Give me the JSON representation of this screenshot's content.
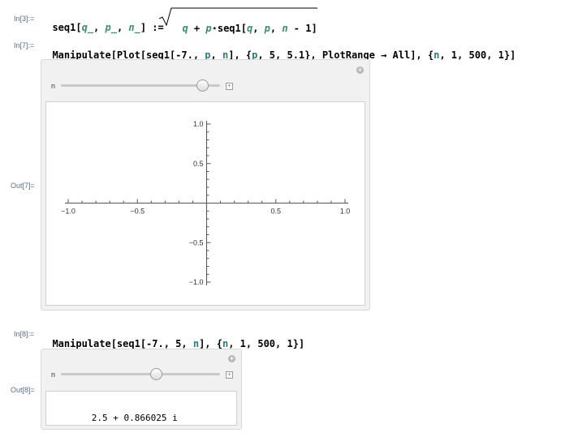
{
  "cells": {
    "in3": {
      "label": "In[3]:=",
      "code": {
        "head": "seq1[",
        "q": "q_",
        "sep1": ", ",
        "p": "p_",
        "sep2": ", ",
        "n": "n_",
        "close": "] :=",
        "rad_q": "q",
        "rad_plus": " + ",
        "rad_p": "p",
        "rad_star": "⋆",
        "rad_seq": "seq1[",
        "rad_q2": "q",
        "rad_c1": ", ",
        "rad_p2": "p",
        "rad_c2": ", ",
        "rad_n": "n",
        "rad_tail": " - 1]"
      }
    },
    "in7": {
      "label": "In[7]:=",
      "code": {
        "a": "Manipulate[Plot[seq1[-7., ",
        "p": "p",
        "b": ", ",
        "n": "n",
        "c": "], {",
        "p2": "p",
        "d": ", 5, 5.1}, PlotRange → All], {",
        "n2": "n",
        "e": ", 1, 500, 1}]"
      }
    },
    "out7": {
      "label": "Out[7]=",
      "slider_label": "n",
      "slider_fraction": 0.92
    },
    "in8": {
      "label": "In[8]:=",
      "code": {
        "a": "Manipulate[seq1[-7., 5, ",
        "n": "n",
        "b": "], {",
        "n2": "n",
        "c": ", 1, 500, 1}]"
      }
    },
    "out8": {
      "label": "Out[8]=",
      "slider_label": "n",
      "slider_fraction": 0.61,
      "result_main": "2.5 + 0.866025 ",
      "result_i": "i"
    }
  },
  "chart_data": {
    "type": "line",
    "series": [],
    "xlim": [
      -1.0,
      1.0
    ],
    "ylim": [
      -1.0,
      1.0
    ],
    "x_ticks": [
      "-1.0",
      "-0.5",
      "0.5",
      "1.0"
    ],
    "y_ticks": [
      "1.0",
      "0.5",
      "-0.5",
      "-1.0"
    ],
    "title": "",
    "xlabel": "",
    "ylabel": "",
    "grid": false
  }
}
